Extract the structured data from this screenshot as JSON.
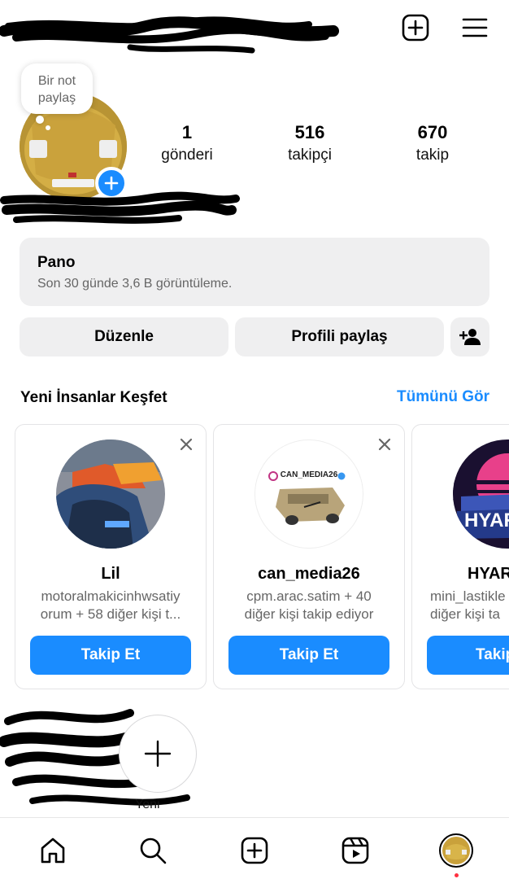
{
  "header": {
    "username": "",
    "new_post_icon": "plus-square-icon",
    "menu_icon": "hamburger-icon"
  },
  "profile": {
    "note_bubble": "Bir not\npaylaş",
    "stats": [
      {
        "value": "1",
        "label": "gönderi"
      },
      {
        "value": "516",
        "label": "takipçi"
      },
      {
        "value": "670",
        "label": "takip"
      }
    ]
  },
  "dashboard": {
    "title": "Pano",
    "subtitle": "Son 30 günde 3,6 B görüntüleme."
  },
  "actions": {
    "edit_label": "Düzenle",
    "share_label": "Profili paylaş",
    "discover_icon": "person-add-icon"
  },
  "discover": {
    "title": "Yeni İnsanlar Keşfet",
    "see_all": "Tümünü Gör",
    "cards": [
      {
        "name": "Lil",
        "description": "motoralmakicinhwsatiy\norum + 58 diğer kişi t...",
        "button": "Takip Et"
      },
      {
        "name": "can_media26",
        "description": "cpm.arac.satim + 40\ndiğer kişi takip ediyor",
        "button": "Takip Et",
        "avatar_text": "CAN_MEDIA26"
      },
      {
        "name": "HYAR",
        "description": "mini_lastikle\ndiğer kişi ta",
        "button": "Takip Et",
        "avatar_text": "HYAR"
      }
    ]
  },
  "highlights": {
    "new_label": "Yeni"
  },
  "colors": {
    "accent": "#1a8cff",
    "button_gray": "#efeff0",
    "muted_text": "#666666",
    "notification_dot": "#ff3040"
  },
  "bottom_nav": [
    "home-icon",
    "search-icon",
    "create-icon",
    "reels-icon",
    "profile-avatar"
  ]
}
